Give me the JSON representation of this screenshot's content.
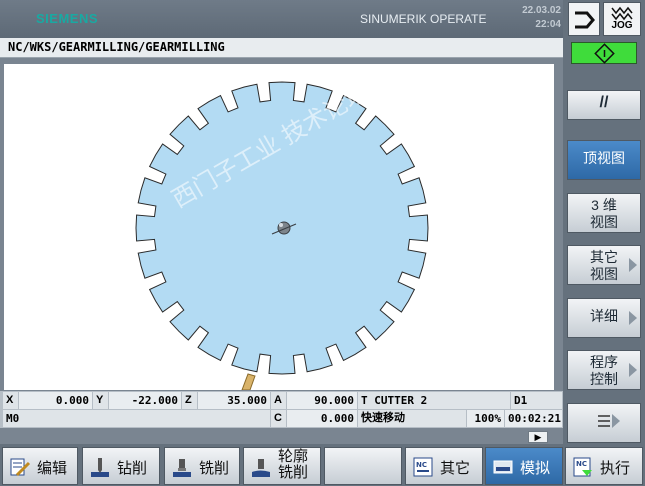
{
  "header": {
    "brand": "SIEMENS",
    "app_title": "SINUMERIK OPERATE",
    "date": "22.03.02",
    "time": "22:04"
  },
  "path": "NC/WKS/GEARMILLING/GEARMILLING",
  "watermark": "西门子工业 技术论坛 support.industry.siemens.com/cs",
  "status": {
    "row1": {
      "x_label": "X",
      "x_value": "0.000",
      "y_label": "Y",
      "y_value": "-22.000",
      "z_label": "Z",
      "z_value": "35.000",
      "a_label": "A",
      "a_value": "90.000",
      "tool": "T CUTTER 2",
      "d": "D1"
    },
    "row2": {
      "m": "M0",
      "c_label": "C",
      "c_value": "0.000",
      "mode": "快速移动",
      "override": "100%",
      "elapsed": "00:02:21"
    }
  },
  "right_panel": {
    "mode_label": "JOG",
    "softkeys": [
      "//",
      "顶视图",
      "3 维\n视图",
      "其它\n视图",
      "详细",
      "程序\n控制"
    ]
  },
  "bottom_bar": [
    {
      "label": "编辑",
      "icon": "edit-icon"
    },
    {
      "label": "钻削",
      "icon": "drill-icon"
    },
    {
      "label": "铣削",
      "icon": "mill-icon"
    },
    {
      "label": "轮廓\n铣削",
      "icon": "contour-mill-icon"
    },
    {
      "label": "",
      "icon": ""
    },
    {
      "label": "其它",
      "icon": "nc-other-icon"
    },
    {
      "label": "模拟",
      "icon": "simulation-icon"
    },
    {
      "label": "执行",
      "icon": "execute-icon"
    }
  ],
  "colors": {
    "accent_green": "#3fdc3b",
    "part_fill": "#b3dbf3",
    "active_blue": "#2e69a6"
  },
  "drawing": {
    "tooth_count": 24
  }
}
